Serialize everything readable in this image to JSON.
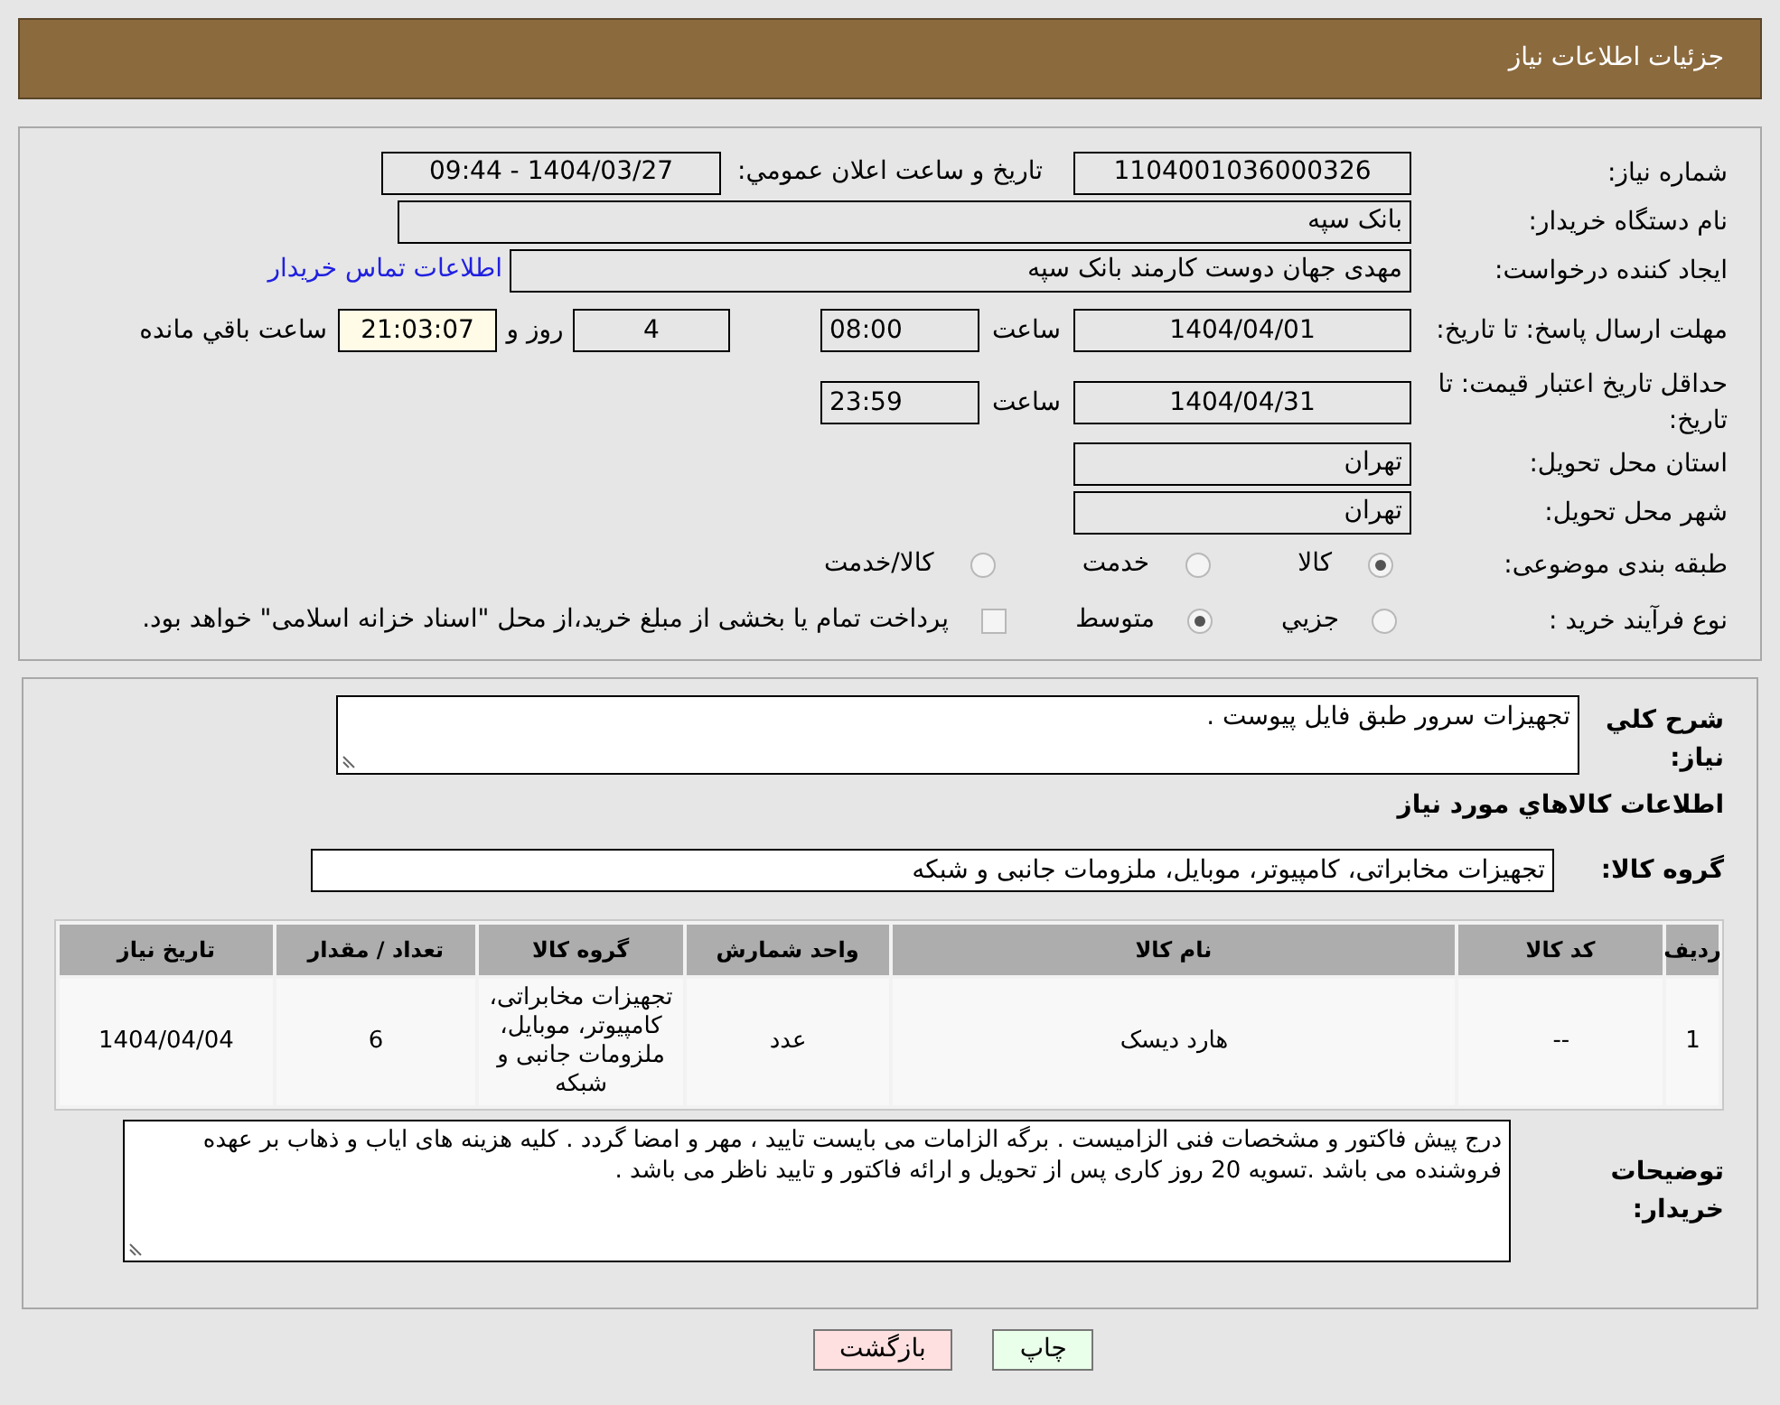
{
  "header": {
    "title": "جزئیات اطلاعات نیاز"
  },
  "need_number": {
    "label": "شماره نیاز:",
    "value": "1104001036000326"
  },
  "announce": {
    "label": "تاریخ و ساعت اعلان عمومي:",
    "value": "1404/03/27 - 09:44"
  },
  "buyer_org": {
    "label": "نام دستگاه خریدار:",
    "value": "بانک سپه"
  },
  "creator": {
    "label": "ایجاد کننده درخواست:",
    "value": "مهدی جهان دوست کارمند بانک سپه",
    "link": "اطلاعات تماس خریدار"
  },
  "reply_deadline": {
    "label": "مهلت ارسال پاسخ: تا تاریخ:",
    "date": "1404/04/01",
    "time_label": "ساعت",
    "time": "08:00",
    "days": "4",
    "days_label": "روز و",
    "remaining": "21:03:07",
    "remaining_label": "ساعت باقي مانده"
  },
  "price_validity": {
    "label": "حداقل تاریخ اعتبار قیمت: تا تاریخ:",
    "date": "1404/04/31",
    "time_label": "ساعت",
    "time": "23:59"
  },
  "province": {
    "label": "استان محل تحویل:",
    "value": "تهران"
  },
  "city": {
    "label": "شهر محل تحویل:",
    "value": "تهران"
  },
  "category": {
    "label": "طبقه بندی موضوعی:",
    "options": [
      {
        "label": "کالا",
        "selected": true
      },
      {
        "label": "خدمت",
        "selected": false
      },
      {
        "label": "کالا/خدمت",
        "selected": false
      }
    ]
  },
  "purchase_type": {
    "label": "نوع فرآیند خرید :",
    "options": [
      {
        "kind": "radio",
        "label": "جزيي",
        "selected": false
      },
      {
        "kind": "radio",
        "label": "متوسط",
        "selected": true
      },
      {
        "kind": "checkbox",
        "label": "پرداخت تمام یا بخشی از مبلغ خرید،از محل \"اسناد خزانه اسلامی\" خواهد بود.",
        "checked": false
      }
    ]
  },
  "summary": {
    "label": "شرح کلي نیاز:",
    "value": "تجهیزات سرور طبق فایل پیوست ."
  },
  "goods_title": "اطلاعات کالاهاي مورد نیاز",
  "goods_group": {
    "label": "گروه کالا:",
    "value": "تجهیزات مخابراتی، کامپیوتر، موبایل، ملزومات جانبی و شبکه"
  },
  "table": {
    "columns": [
      "ردیف",
      "کد کالا",
      "نام کالا",
      "واحد شمارش",
      "گروه کالا",
      "تعداد / مقدار",
      "تاریخ نیاز"
    ],
    "rows": [
      [
        "1",
        "--",
        "هارد دیسک",
        "عدد",
        "تجهیزات مخابراتی، کامپیوتر، موبایل، ملزومات جانبی و شبکه",
        "6",
        "1404/04/04"
      ]
    ]
  },
  "buyer_notes": {
    "label": "توضیحات خریدار:",
    "value": "درج پیش فاکتور و مشخصات فنی الزامیست . برگه الزامات می بایست تایید ، مهر و امضا گردد . کلیه هزینه های ایاب و ذهاب بر عهده فروشنده می باشد .تسویه 20 روز کاری پس از تحویل و ارائه فاکتور و تایید ناظر می باشد ."
  },
  "buttons": [
    {
      "kind": "print",
      "label": "چاپ"
    },
    {
      "kind": "back",
      "label": "بازگشت"
    }
  ]
}
